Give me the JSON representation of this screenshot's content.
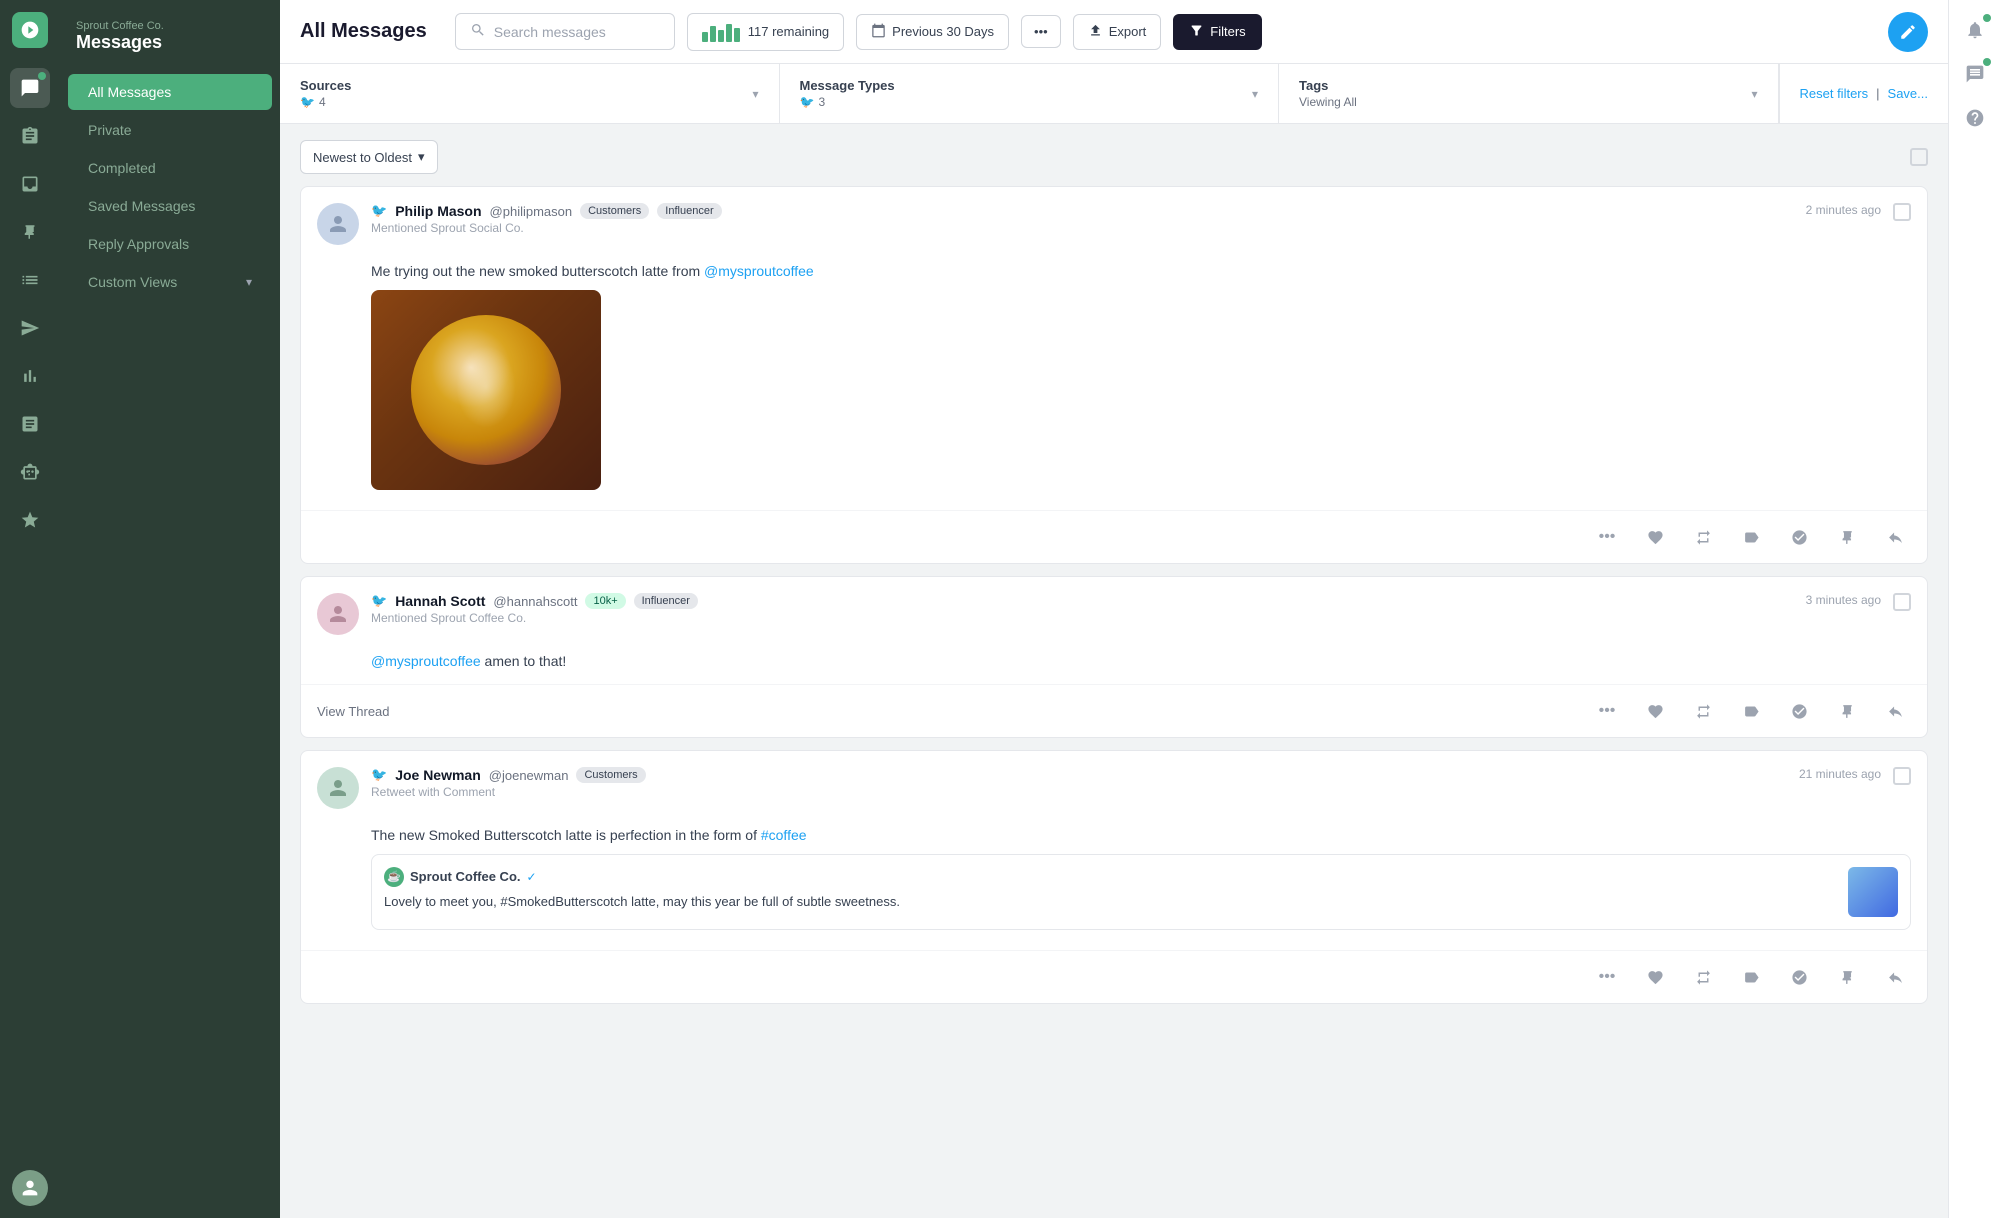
{
  "app": {
    "company": "Sprout Coffee Co.",
    "section": "Messages"
  },
  "sidebar": {
    "items": [
      {
        "id": "all-messages",
        "label": "All Messages",
        "active": true
      },
      {
        "id": "private",
        "label": "Private",
        "active": false
      },
      {
        "id": "completed",
        "label": "Completed",
        "active": false
      },
      {
        "id": "saved-messages",
        "label": "Saved Messages",
        "active": false
      },
      {
        "id": "reply-approvals",
        "label": "Reply Approvals",
        "active": false
      },
      {
        "id": "custom-views",
        "label": "Custom Views",
        "active": false
      }
    ]
  },
  "topbar": {
    "page_title": "All Messages",
    "search_placeholder": "Search messages",
    "remaining_label": "117 remaining",
    "date_label": "Previous 30 Days",
    "export_label": "Export",
    "filters_label": "Filters"
  },
  "filters": {
    "sources_label": "Sources",
    "sources_count": "4",
    "message_types_label": "Message Types",
    "message_types_count": "3",
    "tags_label": "Tags",
    "tags_sub": "Viewing All",
    "reset_label": "Reset filters",
    "save_label": "Save..."
  },
  "sort": {
    "label": "Newest to Oldest"
  },
  "messages": [
    {
      "id": "msg1",
      "author": "Philip Mason",
      "handle": "@philipmason",
      "tags": [
        "Customers",
        "Influencer"
      ],
      "sub": "Mentioned Sprout Social Co.",
      "time": "2 minutes ago",
      "body": "Me trying out the new smoked butterscotch latte from @mysproutcoffee",
      "mention": "@mysproutcoffee",
      "has_image": true,
      "avatar_color": "#c8d5e8"
    },
    {
      "id": "msg2",
      "author": "Hannah Scott",
      "handle": "@hannahscott",
      "tags": [
        "10k+",
        "Influencer"
      ],
      "tag_10k_green": true,
      "sub": "Mentioned Sprout Coffee Co.",
      "time": "3 minutes ago",
      "body": "@mysproutcoffee amen to that!",
      "mention": "@mysproutcoffee",
      "has_image": false,
      "has_view_thread": true,
      "avatar_color": "#e8c8d5"
    },
    {
      "id": "msg3",
      "author": "Joe Newman",
      "handle": "@joenewman",
      "tags": [
        "Customers"
      ],
      "sub": "Retweet with Comment",
      "time": "21 minutes ago",
      "body": "The new Smoked Butterscotch latte is perfection in the form of #coffee",
      "hashtag": "#coffee",
      "has_image": false,
      "has_quoted": true,
      "quoted": {
        "author": "Sprout Coffee Co.",
        "verified": true,
        "text": "Lovely to meet you, #SmokedButterscotch latte, may this year be full of subtle sweetness."
      },
      "avatar_color": "#c8e0d5"
    }
  ],
  "right_sidebar": {
    "notifications_icon": "bell",
    "chat_icon": "chat",
    "help_icon": "question-mark"
  }
}
